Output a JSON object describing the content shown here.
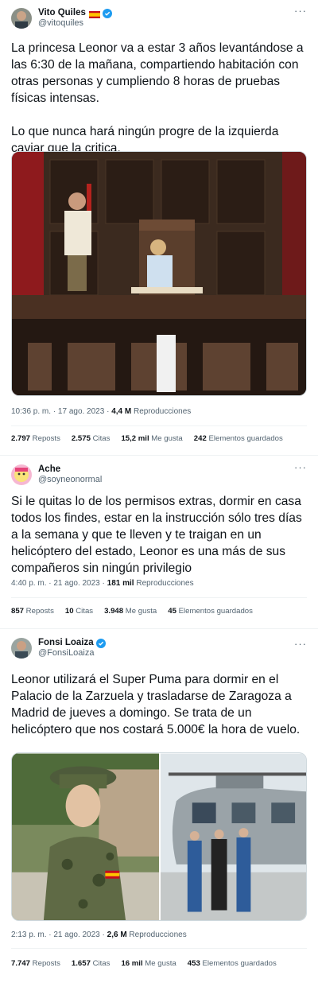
{
  "tweets": [
    {
      "name": "Vito Quiles",
      "handle": "@vitoquiles",
      "text": "La princesa Leonor va a estar 3 años levantándose a las 6:30 de la mañana, compartiendo habitación con otras personas y cumpliendo 8 horas de pruebas físicas intensas.\n\nLo que nunca hará ningún progre de la izquierda caviar que la critica.",
      "time": "10:36 p. m. · 17 ago. 2023 · ",
      "views": "4,4 M",
      "views_label": " Reproducciones",
      "reposts": "2.797",
      "reposts_label": " Reposts",
      "quotes": "2.575",
      "quotes_label": " Citas",
      "likes": "15,2 mil",
      "likes_label": " Me gusta",
      "bookmarks": "242",
      "bookmarks_label": " Elementos guardados"
    },
    {
      "name": "Ache",
      "handle": "@soyneonormal",
      "text": "Si le quitas lo de los permisos extras, dormir en casa todos los findes, estar en la instrucción sólo tres días a la semana y que te lleven y te traigan en un helicóptero del estado, Leonor es una más de sus compañeros sin ningún privilegio",
      "time": "4:40 p. m. · 21 ago. 2023 · ",
      "views": "181 mil",
      "views_label": " Reproducciones",
      "reposts": "857",
      "reposts_label": " Reposts",
      "quotes": "10",
      "quotes_label": " Citas",
      "likes": "3.948",
      "likes_label": " Me gusta",
      "bookmarks": "45",
      "bookmarks_label": " Elementos guardados"
    },
    {
      "name": "Fonsi Loaiza",
      "handle": "@FonsiLoaiza",
      "text": "Leonor utilizará el Super Puma para dormir en el Palacio de la Zarzuela y trasladarse de Zaragoza a Madrid de jueves a domingo. Se trata de un helicóptero que nos costará 5.000€ la hora de vuelo.",
      "time": "2:13 p. m. · 21 ago. 2023 · ",
      "views": "2,6 M",
      "views_label": " Reproducciones",
      "reposts": "7.747",
      "reposts_label": " Reposts",
      "quotes": "1.657",
      "quotes_label": " Citas",
      "likes": "16 mil",
      "likes_label": " Me gusta",
      "bookmarks": "453",
      "bookmarks_label": " Elementos guardados"
    }
  ],
  "more_glyph": "···",
  "colors": {
    "text": "#0f1419",
    "secondary": "#536471",
    "verified": "#1d9bf0",
    "border": "#eff3f4"
  },
  "icons": [
    "verified-badge-icon",
    "spain-flag-icon",
    "more-options-icon"
  ]
}
